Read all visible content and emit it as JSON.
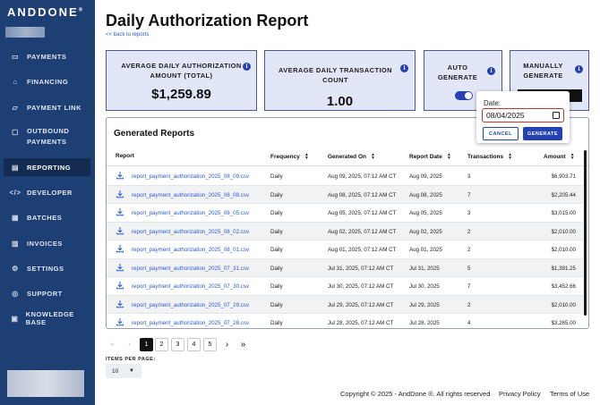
{
  "sidebar": {
    "logo": "ANDDONE",
    "logo_mark": "®",
    "items": [
      {
        "label": "PAYMENTS",
        "icon": "card-icon"
      },
      {
        "label": "FINANCING",
        "icon": "bank-icon"
      },
      {
        "label": "PAYMENT LINK",
        "icon": "link-icon"
      },
      {
        "label": "OUTBOUND",
        "label2": "PAYMENTS",
        "icon": "outbound-icon"
      },
      {
        "label": "REPORTING",
        "icon": "report-icon"
      },
      {
        "label": "DEVELOPER",
        "icon": "code-icon"
      },
      {
        "label": "BATCHES",
        "icon": "batches-icon"
      },
      {
        "label": "INVOICES",
        "icon": "invoice-icon"
      },
      {
        "label": "SETTINGS",
        "icon": "gear-icon"
      },
      {
        "label": "SUPPORT",
        "icon": "support-icon"
      },
      {
        "label": "KNOWLEDGE BASE",
        "icon": "book-icon"
      }
    ]
  },
  "header": {
    "title": "Daily Authorization Report",
    "back_link": "<< back to reports"
  },
  "cards": {
    "avg_amount": {
      "label1": "AVERAGE DAILY AUTHORIZATION",
      "label2": "AMOUNT (TOTAL)",
      "value": "$1,259.89"
    },
    "avg_count": {
      "label": "AVERAGE DAILY TRANSACTION COUNT",
      "value": "1.00"
    },
    "auto_generate": {
      "label1": "AUTO",
      "label2": "GENERATE",
      "enabled": true
    },
    "manual_generate": {
      "label1": "MANUALLY",
      "label2": "GENERATE"
    }
  },
  "popover": {
    "date_label": "Date:",
    "date_value": "08/04/2025",
    "cancel_label": "CANCEL",
    "generate_label": "GENERATE"
  },
  "reports": {
    "title": "Generated Reports",
    "columns": [
      "Report",
      "Frequency",
      "Generated On",
      "Report Date",
      "Transactions",
      "Amount"
    ],
    "rows": [
      {
        "file": "report_payment_authorization_2025_08_09.csv",
        "frequency": "Daily",
        "generated": "Aug 09, 2025, 07:12 AM CT",
        "date": "Aug 09, 2025",
        "transactions": "3",
        "amount": "$6,903.71"
      },
      {
        "file": "report_payment_authorization_2025_08_08.csv",
        "frequency": "Daily",
        "generated": "Aug 08, 2025, 07:12 AM CT",
        "date": "Aug 08, 2025",
        "transactions": "7",
        "amount": "$2,205.44"
      },
      {
        "file": "report_payment_authorization_2025_08_05.csv",
        "frequency": "Daily",
        "generated": "Aug 05, 2025, 07:12 AM CT",
        "date": "Aug 05, 2025",
        "transactions": "3",
        "amount": "$3,015.00"
      },
      {
        "file": "report_payment_authorization_2025_08_02.csv",
        "frequency": "Daily",
        "generated": "Aug 02, 2025, 07:12 AM CT",
        "date": "Aug 02, 2025",
        "transactions": "2",
        "amount": "$2,010.00"
      },
      {
        "file": "report_payment_authorization_2025_08_01.csv",
        "frequency": "Daily",
        "generated": "Aug 01, 2025, 07:12 AM CT",
        "date": "Aug 01, 2025",
        "transactions": "2",
        "amount": "$2,010.00"
      },
      {
        "file": "report_payment_authorization_2025_07_31.csv",
        "frequency": "Daily",
        "generated": "Jul 31, 2025, 07:12 AM CT",
        "date": "Jul 31, 2025",
        "transactions": "5",
        "amount": "$1,391.25"
      },
      {
        "file": "report_payment_authorization_2025_07_30.csv",
        "frequency": "Daily",
        "generated": "Jul 30, 2025, 07:12 AM CT",
        "date": "Jul 30, 2025",
        "transactions": "7",
        "amount": "$3,452.66"
      },
      {
        "file": "report_payment_authorization_2025_07_29.csv",
        "frequency": "Daily",
        "generated": "Jul 29, 2025, 07:12 AM CT",
        "date": "Jul 29, 2025",
        "transactions": "2",
        "amount": "$2,010.00"
      },
      {
        "file": "report_payment_authorization_2025_07_28.csv",
        "frequency": "Daily",
        "generated": "Jul 28, 2025, 07:12 AM CT",
        "date": "Jul 28, 2025",
        "transactions": "4",
        "amount": "$3,265.00"
      }
    ]
  },
  "pagination": {
    "first": "«",
    "prev": "‹",
    "pages": [
      "1",
      "2",
      "3",
      "4",
      "5"
    ],
    "next": "›",
    "last": "»",
    "items_per_page_label": "ITEMS PER PAGE:",
    "items_per_page_value": "10"
  },
  "footer": {
    "copyright": "Copyright © 2025 - AndDone ®. All rights reserved",
    "privacy": "Privacy Policy",
    "terms": "Terms of Use"
  },
  "colors": {
    "sidebar_bg": "#1e3f73",
    "accent": "#2442b6",
    "card_bg": "#e2e7f8",
    "link": "#2b5bd1"
  }
}
